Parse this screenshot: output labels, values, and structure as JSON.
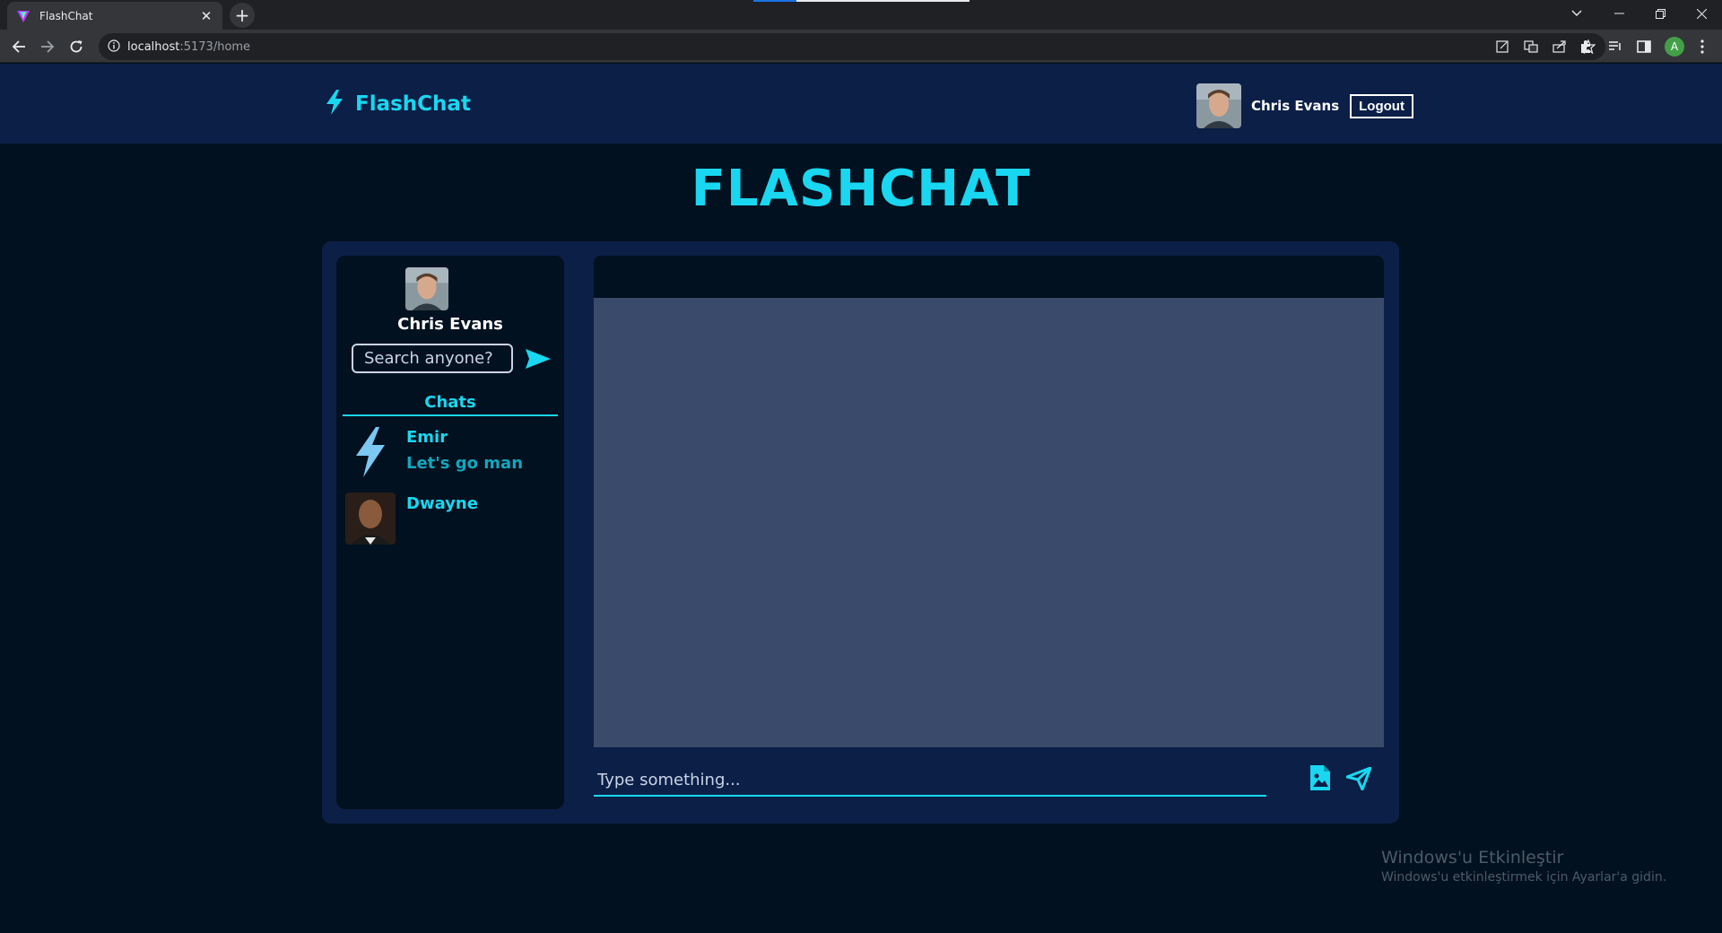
{
  "browser": {
    "tab_title": "FlashChat",
    "url_host": "localhost",
    "url_path": ":5173/home",
    "profile_initial": "A"
  },
  "nav": {
    "brand": "FlashChat",
    "username": "Chris Evans",
    "logout_label": "Logout"
  },
  "page_title": "FLASHCHAT",
  "sidebar": {
    "username": "Chris Evans",
    "search_placeholder": "Search anyone?",
    "chats_label": "Chats",
    "chats": [
      {
        "name": "Emir",
        "last_message": "Let's go man",
        "avatar": "lightning-icon"
      },
      {
        "name": "Dwayne",
        "last_message": "",
        "avatar": "user-photo"
      }
    ]
  },
  "chat": {
    "message_placeholder": "Type something..."
  },
  "windows_activation": {
    "title": "Windows'u Etkinleştir",
    "subtitle": "Windows'u etkinleştirmek için Ayarlar'a gidin."
  },
  "colors": {
    "accent": "#19d7f0",
    "background": "#02111f",
    "navy": "#0b1f47",
    "chat_area": "#3a4a6b"
  }
}
